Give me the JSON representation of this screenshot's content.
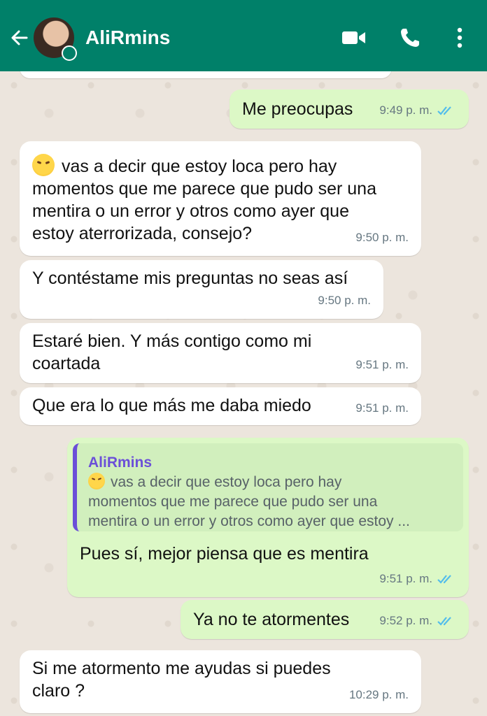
{
  "header": {
    "contact_name": "AliRmins"
  },
  "messages": [
    {
      "dir": "out",
      "text": "Me preocupas",
      "time": "9:49 p. m.",
      "read": true
    },
    {
      "dir": "in",
      "emoji": "tired-face-emoji",
      "lines": [
        "vas a decir que estoy loca pero hay",
        "momentos que me parece que pudo ser una",
        "mentira o un error y otros como ayer que",
        "estoy aterrorizada, consejo?"
      ],
      "time": "9:50 p. m."
    },
    {
      "dir": "in",
      "text": "Y contéstame mis preguntas no seas así",
      "time": "9:50 p. m."
    },
    {
      "dir": "in",
      "lines": [
        "Estaré bien. Y más contigo como mi",
        "coartada"
      ],
      "time": "9:51 p. m."
    },
    {
      "dir": "in",
      "text": "Que era lo que más me daba miedo",
      "time": "9:51 p. m."
    },
    {
      "dir": "out",
      "quote": {
        "name": "AliRmins",
        "lines": [
          "vas a decir que estoy loca pero hay",
          "momentos que me parece que pudo ser una",
          "mentira o un error y otros como ayer que estoy ..."
        ]
      },
      "text": "Pues sí, mejor piensa que es mentira",
      "time": "9:51 p. m.",
      "read": true
    },
    {
      "dir": "out",
      "text": "Ya no te atormentes",
      "time": "9:52 p. m.",
      "read": true
    },
    {
      "dir": "in",
      "lines": [
        "Si me atormento me ayudas si puedes",
        "claro ?"
      ],
      "time": "10:29 p. m."
    }
  ],
  "colors": {
    "header": "#008069",
    "incoming_bubble": "#ffffff",
    "outgoing_bubble": "#dcf8c6",
    "read_ticks": "#53bdeb",
    "quote_accent": "#6b4fd8"
  }
}
